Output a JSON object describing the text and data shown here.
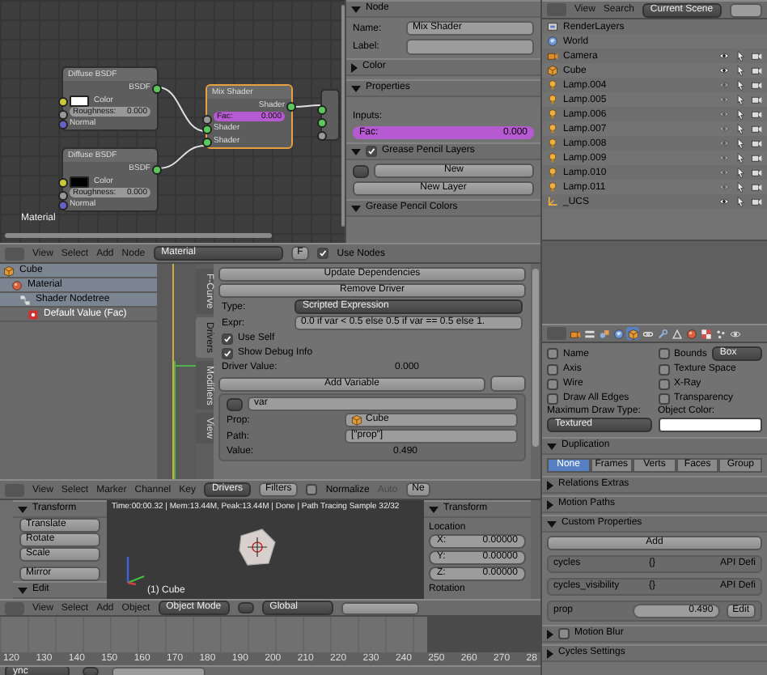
{
  "node_editor": {
    "frame_label": "Material",
    "diffuse_nodes": [
      {
        "title": "Diffuse BSDF",
        "output": "BSDF",
        "color_label": "Color",
        "color": "#ffffff",
        "roughness_label": "Roughness:",
        "roughness_value": "0.000",
        "normal": "Normal"
      },
      {
        "title": "Diffuse BSDF",
        "output": "BSDF",
        "color_label": "Color",
        "color": "#000000",
        "roughness_label": "Roughness:",
        "roughness_value": "0.000",
        "normal": "Normal"
      }
    ],
    "mix_node": {
      "title": "Mix Shader",
      "output": "Shader",
      "fac_label": "Fac:",
      "fac_value": "0.000",
      "inputs": [
        "Shader",
        "Shader"
      ]
    }
  },
  "node_sidebar": {
    "node_panel": {
      "title": "Node",
      "expanded": true
    },
    "name_label": "Name:",
    "name_value": "Mix Shader",
    "label_label": "Label:",
    "color_panel": {
      "title": "Color",
      "expanded": false
    },
    "properties_panel": {
      "title": "Properties",
      "expanded": true
    },
    "inputs_label": "Inputs:",
    "fac_label": "Fac:",
    "fac_value": "0.000",
    "grease_panel": {
      "title": "Grease Pencil Layers",
      "expanded": true,
      "checked": true
    },
    "new_button": "New",
    "new_layer_button": "New Layer",
    "colors_panel": {
      "title": "Grease Pencil Colors",
      "expanded": true
    }
  },
  "outliner": {
    "menus": [
      "View",
      "Search"
    ],
    "scene": "Current Scene",
    "items": [
      {
        "name": "RenderLayers",
        "kind": "render"
      },
      {
        "name": "World",
        "kind": "world"
      },
      {
        "name": "Camera",
        "kind": "camera",
        "visible": true
      },
      {
        "name": "Cube",
        "kind": "mesh",
        "visible": true
      },
      {
        "name": "Lamp.004",
        "kind": "lamp",
        "visible": false
      },
      {
        "name": "Lamp.005",
        "kind": "lamp",
        "visible": false
      },
      {
        "name": "Lamp.006",
        "kind": "lamp",
        "visible": false
      },
      {
        "name": "Lamp.007",
        "kind": "lamp",
        "visible": false
      },
      {
        "name": "Lamp.008",
        "kind": "lamp",
        "visible": false
      },
      {
        "name": "Lamp.009",
        "kind": "lamp",
        "visible": false
      },
      {
        "name": "Lamp.010",
        "kind": "lamp",
        "visible": false
      },
      {
        "name": "Lamp.011",
        "kind": "lamp",
        "visible": false
      },
      {
        "name": "_UCS",
        "kind": "empty",
        "visible": true
      }
    ]
  },
  "node_header": {
    "menus": [
      "View",
      "Select",
      "Add",
      "Node"
    ],
    "material": "Material",
    "users": "F",
    "use_nodes": {
      "label": "Use Nodes",
      "checked": true
    }
  },
  "channels": [
    {
      "name": "Cube",
      "kind": "object",
      "children": [
        {
          "name": "Material",
          "kind": "material",
          "children": [
            {
              "name": "Shader Nodetree",
              "kind": "nodetree",
              "children": [
                {
                  "name": "Default Value (Fac)",
                  "kind": "driver"
                }
              ]
            }
          ]
        }
      ]
    }
  ],
  "graph_tabs": [
    {
      "label": "F-Curve",
      "selected": false
    },
    {
      "label": "Drivers",
      "selected": true
    },
    {
      "label": "Modifiers",
      "selected": false
    },
    {
      "label": "View",
      "selected": false
    }
  ],
  "driver": {
    "update_button": "Update Dependencies",
    "remove_button": "Remove Driver",
    "type_label": "Type:",
    "type_value": "Scripted Expression",
    "expr_label": "Expr:",
    "expr_value": "0.0 if var < 0.5 else 0.5 if var == 0.5 else 1.",
    "use_self": {
      "label": "Use Self",
      "checked": true
    },
    "show_debug": {
      "label": "Show Debug Info",
      "checked": true
    },
    "driver_value_label": "Driver Value:",
    "driver_value": "0.000",
    "add_variable": "Add Variable",
    "variable": {
      "name": "var",
      "prop_label": "Prop:",
      "prop_value": "Cube",
      "path_label": "Path:",
      "path_value": "[\"prop\"]",
      "value_label": "Value:",
      "value": "0.490"
    }
  },
  "graph_header": {
    "menus": [
      "View",
      "Select",
      "Marker",
      "Channel",
      "Key"
    ],
    "mode": "Drivers",
    "filters": "Filters",
    "normalize": {
      "label": "Normalize",
      "checked": false
    },
    "auto": "Auto",
    "new": "Ne"
  },
  "view3d": {
    "tool_panel": {
      "title": "Transform",
      "buttons": [
        "Translate",
        "Rotate",
        "Scale",
        "Mirror"
      ],
      "edit": "Edit"
    },
    "status": "Time:00:00.32 | Mem:13.44M, Peak:13.44M | Done | Path Tracing Sample 32/32",
    "object_label": "(1) Cube",
    "transform": {
      "title": "Transform",
      "location": "Location",
      "axes": [
        {
          "axis": "X:",
          "value": "0.00000"
        },
        {
          "axis": "Y:",
          "value": "0.00000"
        },
        {
          "axis": "Z:",
          "value": "0.00000"
        }
      ],
      "rotation": "Rotation"
    }
  },
  "view3d_header": {
    "menus": [
      "View",
      "Select",
      "Add",
      "Object"
    ],
    "mode": "Object Mode",
    "orientation": "Global"
  },
  "timeline": {
    "ticks": [
      "120",
      "130",
      "140",
      "150",
      "160",
      "170",
      "180",
      "190",
      "200",
      "210",
      "220",
      "230",
      "240",
      "250",
      "260",
      "270",
      "28"
    ],
    "sync": "ync"
  },
  "properties": {
    "tabs": [
      {
        "kind": "render",
        "selected": false
      },
      {
        "kind": "layers",
        "selected": false
      },
      {
        "kind": "scene",
        "selected": false
      },
      {
        "kind": "world",
        "selected": false
      },
      {
        "kind": "object",
        "selected": true
      },
      {
        "kind": "constraints",
        "selected": false
      },
      {
        "kind": "modifiers",
        "selected": false
      },
      {
        "kind": "data",
        "selected": false
      },
      {
        "kind": "material",
        "selected": false
      },
      {
        "kind": "texture",
        "selected": false
      },
      {
        "kind": "particles",
        "selected": false
      },
      {
        "kind": "physics",
        "selected": false
      }
    ],
    "display_left": [
      {
        "label": "Name",
        "checked": false
      },
      {
        "label": "Axis",
        "checked": false
      },
      {
        "label": "Wire",
        "checked": false
      },
      {
        "label": "Draw All Edges",
        "checked": false
      }
    ],
    "display_right": [
      {
        "label": "Bounds",
        "checked": false
      },
      {
        "label": "Texture Space",
        "checked": false
      },
      {
        "label": "X-Ray",
        "checked": false
      },
      {
        "label": "Transparency",
        "checked": false
      }
    ],
    "bounds_type": "Box",
    "max_draw_label": "Maximum Draw Type:",
    "max_draw": "Textured",
    "object_color_label": "Object Color:",
    "duplication": {
      "title": "Duplication",
      "expanded": true,
      "options": [
        {
          "label": "None",
          "selected": true
        },
        {
          "label": "Frames",
          "selected": false
        },
        {
          "label": "Verts",
          "selected": false
        },
        {
          "label": "Faces",
          "selected": false
        },
        {
          "label": "Group",
          "selected": false
        }
      ]
    },
    "panels_before": [
      {
        "title": "Relations Extras",
        "expanded": false
      },
      {
        "title": "Motion Paths",
        "expanded": false
      }
    ],
    "custom": {
      "title": "Custom Properties",
      "expanded": true,
      "add": "Add",
      "props": [
        {
          "kind": "group",
          "name": "cycles",
          "value": "{}",
          "api": "API Defi"
        },
        {
          "kind": "group",
          "name": "cycles_visibility",
          "value": "{}",
          "api": "API Defi"
        },
        {
          "kind": "number",
          "name": "prop",
          "value": "0.490",
          "edit": "Edit"
        }
      ]
    },
    "panels_after": [
      {
        "title": "Motion Blur",
        "expanded": false,
        "checked": false
      },
      {
        "title": "Cycles Settings",
        "expanded": false
      }
    ]
  }
}
